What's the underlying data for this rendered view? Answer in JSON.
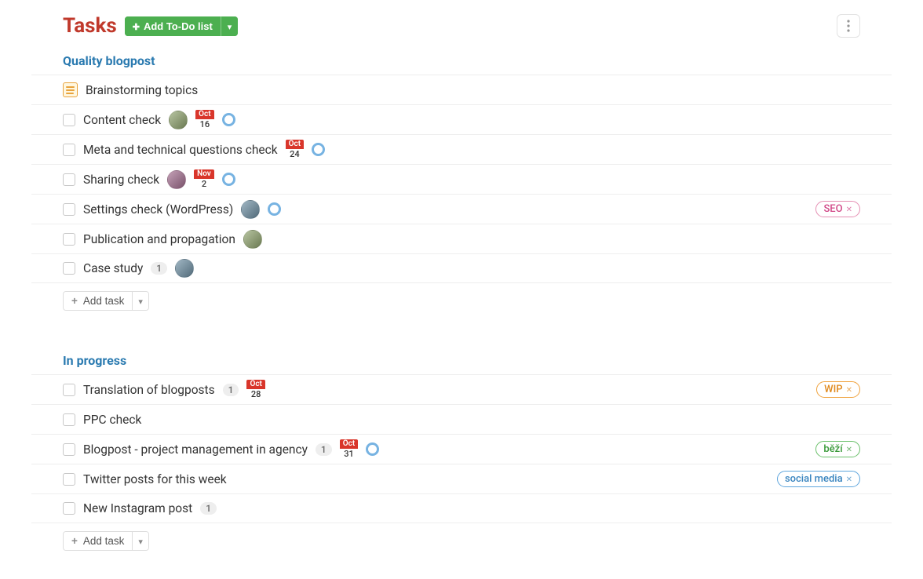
{
  "page_title": "Tasks",
  "add_button_label": "Add To-Do list",
  "add_task_label": "Add task",
  "sections": [
    {
      "title": "Quality blogpost",
      "tasks": [
        {
          "name": "Brainstorming topics",
          "has_notes": true
        },
        {
          "name": "Content check",
          "avatar": "a1",
          "date_month": "Oct",
          "date_day": "16",
          "ring": true
        },
        {
          "name": "Meta and technical questions check",
          "date_month": "Oct",
          "date_day": "24",
          "ring": true
        },
        {
          "name": "Sharing check",
          "avatar": "a2",
          "date_month": "Nov",
          "date_day": "2",
          "ring": true
        },
        {
          "name": "Settings check (WordPress)",
          "avatar": "a3",
          "ring": true,
          "tag": {
            "text": "SEO",
            "class": "tag-seo"
          }
        },
        {
          "name": "Publication and propagation",
          "avatar": "a1"
        },
        {
          "name": "Case study",
          "count": "1",
          "avatar": "a3"
        }
      ]
    },
    {
      "title": "In progress",
      "tasks": [
        {
          "name": "Translation of blogposts",
          "count": "1",
          "date_month": "Oct",
          "date_day": "28",
          "tag": {
            "text": "WIP",
            "class": "tag-wip"
          }
        },
        {
          "name": "PPC check"
        },
        {
          "name": "Blogpost - project management in agency",
          "count": "1",
          "date_month": "Oct",
          "date_day": "31",
          "ring": true,
          "tag": {
            "text": "běží",
            "class": "tag-bezi"
          }
        },
        {
          "name": "Twitter posts for this week",
          "tag": {
            "text": "social media",
            "class": "tag-social"
          }
        },
        {
          "name": "New Instagram post",
          "count": "1"
        }
      ]
    }
  ]
}
